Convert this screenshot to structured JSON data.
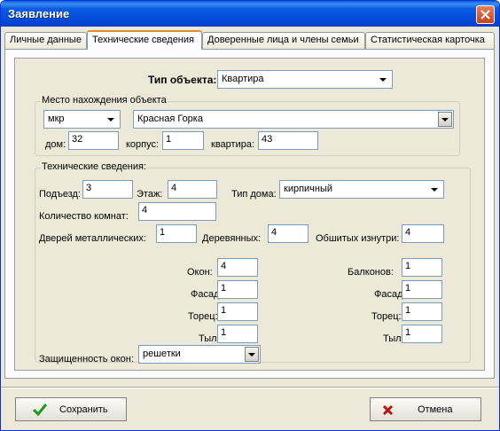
{
  "window": {
    "title": "Заявление"
  },
  "tabs": [
    "Личные данные",
    "Технические сведения",
    "Доверенные лица и члены семьи",
    "Статистическая карточка"
  ],
  "object_type": {
    "label": "Тип объекта:",
    "value": "Квартира"
  },
  "location": {
    "title": "Место нахождения объекта",
    "kind": "мкр",
    "name": "Красная Горка",
    "house_label": "дом:",
    "house": "32",
    "block_label": "корпус:",
    "block": "1",
    "flat_label": "квартира:",
    "flat": "43"
  },
  "tech": {
    "title": "Технические сведения:",
    "entrance_label": "Подъезд:",
    "entrance": "3",
    "floor_label": "Этаж:",
    "floor": "4",
    "house_type_label": "Тип дома:",
    "house_type": "кирпичный",
    "rooms_label": "Количество комнат:",
    "rooms": "4",
    "metal_doors_label": "Дверей металлических:",
    "metal_doors": "1",
    "wood_doors_label": "Деревянных:",
    "wood_doors": "4",
    "padded_doors_label": "Обшитых изнутри:",
    "padded_doors": "4",
    "windows_label": "Окон:",
    "windows": "4",
    "windows_facade_label": "Фасад:",
    "windows_facade": "1",
    "windows_end_label": "Торец:",
    "windows_end": "1",
    "windows_rear_label": "Тыл:",
    "windows_rear": "1",
    "balconies_label": "Балконов:",
    "balconies": "1",
    "balconies_facade_label": "Фасад:",
    "balconies_facade": "1",
    "balconies_end_label": "Торец:",
    "balconies_end": "1",
    "balconies_rear_label": "Тыл:",
    "balconies_rear": "1",
    "protection_label": "Защищенность окон:",
    "protection": "решетки"
  },
  "buttons": {
    "save": "Сохранить",
    "cancel": "Отмена"
  },
  "colors": {
    "title_bar": "#0054e3",
    "active_tab_accent": "#e68b2c",
    "save_check": "#1a9a1a",
    "cancel_x": "#c0100c"
  },
  "icons": {
    "close": "close-icon",
    "save": "checkmark-icon",
    "cancel": "cross-icon"
  }
}
